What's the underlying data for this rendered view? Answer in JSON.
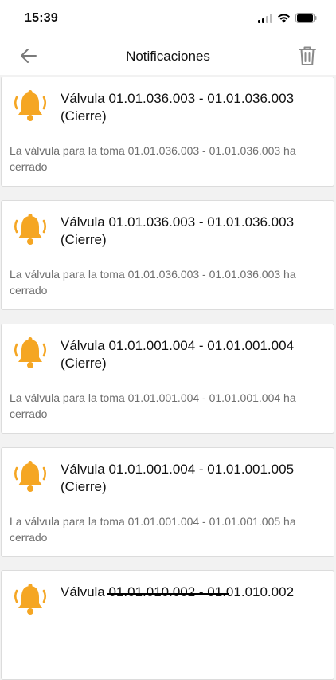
{
  "status": {
    "time": "15:39"
  },
  "header": {
    "title": "Notificaciones"
  },
  "notifications": [
    {
      "title": "Válvula 01.01.036.003 - 01.01.036.003 (Cierre)",
      "body": "La válvula para la toma 01.01.036.003 - 01.01.036.003 ha cerrado"
    },
    {
      "title": "Válvula 01.01.036.003 - 01.01.036.003 (Cierre)",
      "body": "La válvula para la toma 01.01.036.003 - 01.01.036.003 ha cerrado"
    },
    {
      "title": "Válvula 01.01.001.004 - 01.01.001.004 (Cierre)",
      "body": "La válvula para la toma 01.01.001.004 - 01.01.001.004 ha cerrado"
    },
    {
      "title": "Válvula 01.01.001.004 - 01.01.001.005 (Cierre)",
      "body": "La válvula para la toma 01.01.001.004 - 01.01.001.005 ha cerrado"
    },
    {
      "title": "Válvula 01.01.010.002 - 01.01.010.002",
      "body": ""
    }
  ],
  "colors": {
    "bell": "#f5a623",
    "bell_dark": "#d88a0c",
    "accent_text": "#111111",
    "secondary_text": "#6e6e6e"
  }
}
